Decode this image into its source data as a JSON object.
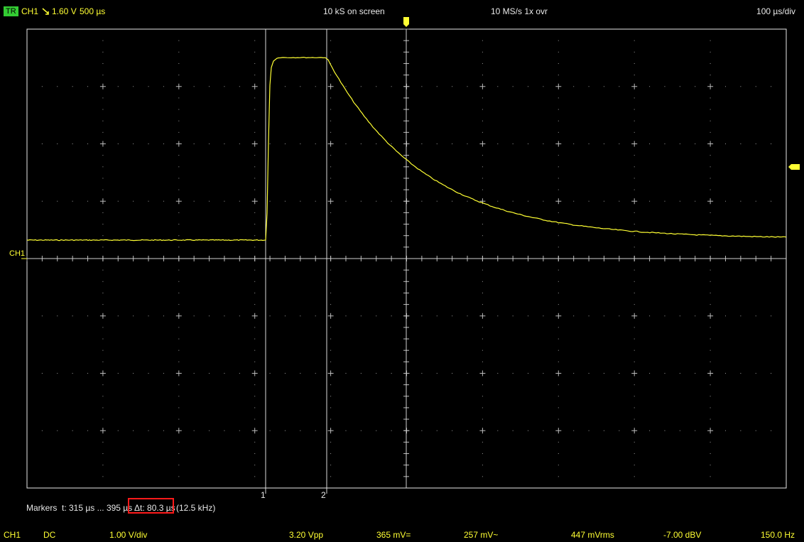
{
  "header": {
    "trigger_badge": "TR",
    "channel": "CH1",
    "slope_icon": "falling-edge-icon",
    "trigger_level": "1.60 V",
    "trigger_time": "500 µs",
    "samples_on_screen": "10 kS on screen",
    "sample_rate": "10 MS/s 1x ovr",
    "timebase": "100 µs/div"
  },
  "screen": {
    "channel_label": "CH1",
    "marker_1_label": "1",
    "marker_2_label": "2",
    "trace_color": "#ffff33",
    "grid_color": "#cfcfcf"
  },
  "markers": {
    "label": "Markers",
    "range": "t: 315 µs ... 395 µs",
    "delta": "Δt: 80.3 µs",
    "frequency": "(12.5 kHz)"
  },
  "footer": {
    "channel": "CH1",
    "coupling": "DC",
    "vdiv": "1.00 V/div",
    "vpp": "3.20 Vpp",
    "mean": "365 mV=",
    "ac": "257 mV~",
    "rms": "447 mVrms",
    "dbv": "-7.00 dBV",
    "freq": "150.0 Hz"
  }
}
